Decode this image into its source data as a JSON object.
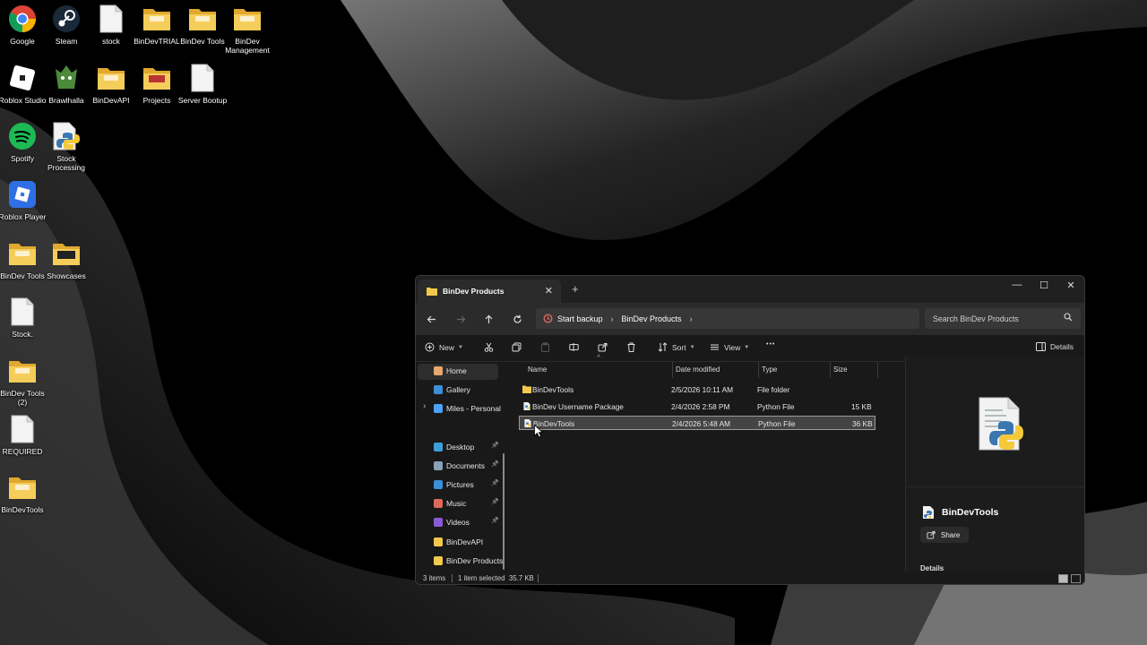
{
  "desktop": {
    "icons": [
      {
        "label": "Google",
        "type": "chrome"
      },
      {
        "label": "Steam",
        "type": "steam"
      },
      {
        "label": "stock",
        "type": "file"
      },
      {
        "label": "BinDevTRIAL",
        "type": "folder"
      },
      {
        "label": "BinDev Tools",
        "type": "folder"
      },
      {
        "label": "BinDev Management",
        "type": "folder"
      },
      {
        "label": "Roblox Studio",
        "type": "roblox-studio"
      },
      {
        "label": "Brawlhalla",
        "type": "brawlhalla"
      },
      {
        "label": "BinDevAPI",
        "type": "folder"
      },
      {
        "label": "Projects",
        "type": "folder-red"
      },
      {
        "label": "Server Bootup",
        "type": "file"
      },
      {
        "label": "Spotify",
        "type": "spotify"
      },
      {
        "label": "Stock Processing",
        "type": "python"
      },
      {
        "label": "Roblox Player",
        "type": "roblox-player"
      },
      {
        "label": "BinDev Tools",
        "type": "folder"
      },
      {
        "label": "Showcases",
        "type": "folder-dark"
      },
      {
        "label": "Stock.",
        "type": "file"
      },
      {
        "label": "BinDev Tools (2)",
        "type": "folder"
      },
      {
        "label": "REQUIRED",
        "type": "file"
      },
      {
        "label": "BinDevTools",
        "type": "folder"
      }
    ]
  },
  "explorer": {
    "tab_title": "BinDev Products",
    "tab_close": "✕",
    "new_tab": "+",
    "window_controls": {
      "minimize": "—",
      "maximize": "☐",
      "close": "✕"
    },
    "address": {
      "crumbs": [
        "Start backup",
        "BinDev Products"
      ],
      "separator": "›"
    },
    "search_placeholder": "Search BinDev Products",
    "toolbar": {
      "new_label": "New",
      "sort_label": "Sort",
      "view_label": "View",
      "more_label": "•••",
      "details_label": "Details"
    },
    "sidebar": {
      "items": [
        {
          "label": "Home",
          "icon": "home-icon",
          "color": "#e8a86b"
        },
        {
          "label": "Gallery",
          "icon": "gallery-icon",
          "color": "#3b8fd9"
        },
        {
          "label": "Miles - Personal",
          "icon": "onedrive-icon",
          "color": "#4aa3ff"
        },
        {
          "label": "Desktop",
          "icon": "desktop-icon",
          "color": "#3aa0d8"
        },
        {
          "label": "Documents",
          "icon": "documents-icon",
          "color": "#8aa1b8"
        },
        {
          "label": "Pictures",
          "icon": "pictures-icon",
          "color": "#3b8fd9"
        },
        {
          "label": "Music",
          "icon": "music-icon",
          "color": "#e0685a"
        },
        {
          "label": "Videos",
          "icon": "videos-icon",
          "color": "#8c5ad6"
        },
        {
          "label": "BinDevAPI",
          "icon": "folder-icon",
          "color": "#f2c94c"
        },
        {
          "label": "BinDev Products",
          "icon": "folder-icon",
          "color": "#f2c94c"
        }
      ]
    },
    "columns": {
      "name": "Name",
      "date": "Date modified",
      "type": "Type",
      "size": "Size"
    },
    "files": [
      {
        "name": "BinDevTools",
        "date": "2/5/2026 10:11 AM",
        "type": "File folder",
        "size": "",
        "icon": "folder-icon"
      },
      {
        "name": "BinDev Username Package",
        "date": "2/4/2026 2:58 PM",
        "type": "Python File",
        "size": "15 KB",
        "icon": "python-file-icon"
      },
      {
        "name": "BinDevTools",
        "date": "2/4/2026 5:48 AM",
        "type": "Python File",
        "size": "36 KB",
        "icon": "python-file-icon"
      }
    ],
    "details_pane": {
      "file_name": "BinDevTools",
      "share_label": "Share",
      "section_header": "Details"
    },
    "status": {
      "items_count": "3 items",
      "selected": "1 item selected",
      "size": "35.7 KB"
    }
  }
}
